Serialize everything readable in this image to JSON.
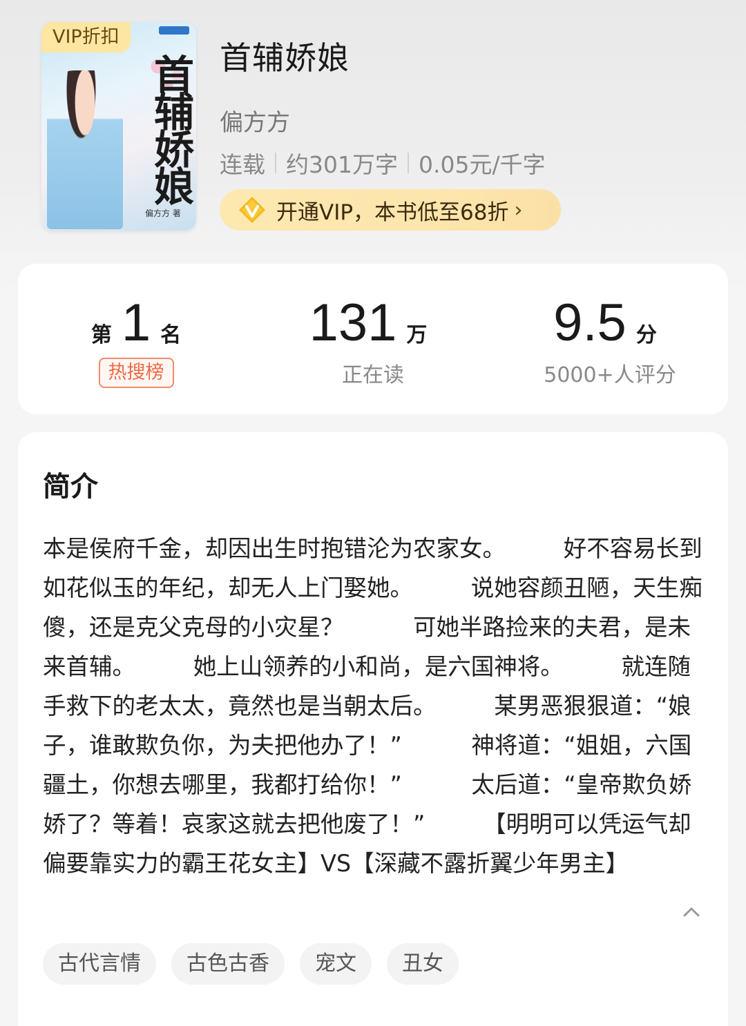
{
  "book": {
    "vip_badge": "VIP折扣",
    "cover_title": "首辅娇娘",
    "cover_author": "偏方方 著",
    "title": "首辅娇娘",
    "author": "偏方方",
    "status": "连载",
    "word_count": "约301万字",
    "price": "0.05元/千字",
    "vip_promo": "开通VIP，本书低至68折"
  },
  "stats": {
    "rank_prefix": "第",
    "rank_value": "1",
    "rank_suffix": "名",
    "rank_list": "热搜榜",
    "reading_value": "131",
    "reading_unit": "万",
    "reading_label": "正在读",
    "score_value": "9.5",
    "score_unit": "分",
    "score_label": "5000+人评分"
  },
  "intro": {
    "heading": "简介",
    "text": "本是侯府千金，却因出生时抱错沦为农家女。　　　好不容易长到如花似玉的年纪，却无人上门娶她。　　　说她容颜丑陋，天生痴傻，还是克父克母的小灾星？　　　可她半路捡来的夫君，是未来首辅。　　　她上山领养的小和尚，是六国神将。　　　就连随手救下的老太太，竟然也是当朝太后。　　　某男恶狠狠道：“娘子，谁敢欺负你，为夫把他办了！”　　　神将道：“姐姐，六国疆土，你想去哪里，我都打给你！”　　　太后道：“皇帝欺负娇娇了？等着！哀家这就去把他废了！”　　　【明明可以凭运气却偏要靠实力的霸王花女主】VS【深藏不露折翼少年男主】",
    "tags": [
      "古代言情",
      "古色古香",
      "宠文",
      "丑女"
    ]
  },
  "colors": {
    "vip_gold": "#fde6a2",
    "hot_tag": "#ef6a45",
    "background": "#f5f5f6"
  }
}
